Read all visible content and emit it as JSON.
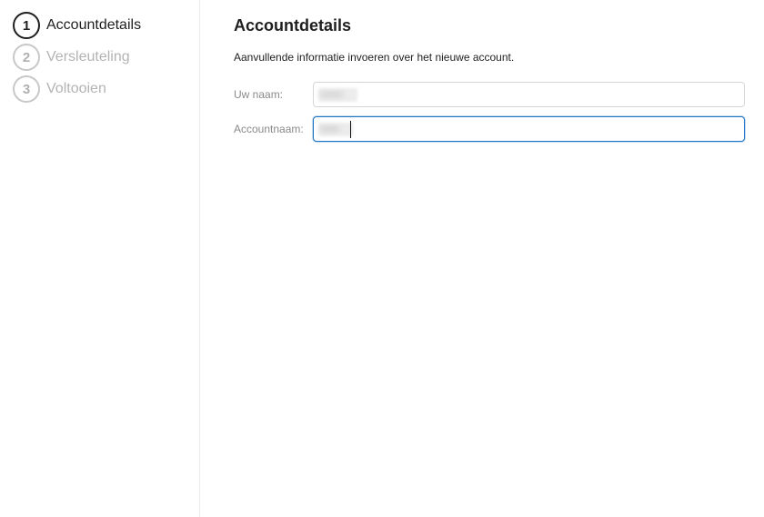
{
  "steps": [
    {
      "number": "1",
      "label": "Accountdetails",
      "active": true
    },
    {
      "number": "2",
      "label": "Versleuteling",
      "active": false
    },
    {
      "number": "3",
      "label": "Voltooien",
      "active": false
    }
  ],
  "main": {
    "title": "Accountdetails",
    "description": "Aanvullende informatie invoeren over het nieuwe account.",
    "fields": {
      "name": {
        "label": "Uw naam:",
        "value": "••••••"
      },
      "account": {
        "label": "Accountnaam:",
        "value": "•••••"
      }
    }
  },
  "colors": {
    "active_step": "#1f1f1f",
    "inactive_step": "#b3b3b3",
    "focus_border": "#1e74c6"
  }
}
